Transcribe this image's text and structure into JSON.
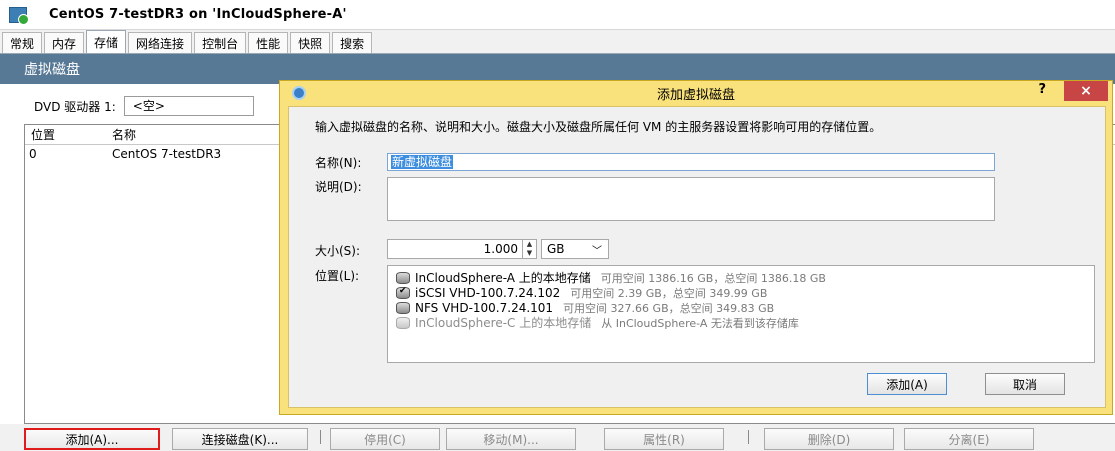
{
  "window": {
    "title": "CentOS 7-testDR3 on 'InCloudSphere-A'"
  },
  "tabs": [
    {
      "label": "常规",
      "active": false
    },
    {
      "label": "内存",
      "active": false
    },
    {
      "label": "存储",
      "active": true
    },
    {
      "label": "网络连接",
      "active": false
    },
    {
      "label": "控制台",
      "active": false
    },
    {
      "label": "性能",
      "active": false
    },
    {
      "label": "快照",
      "active": false
    },
    {
      "label": "搜索",
      "active": false
    }
  ],
  "section": {
    "title": "虚拟磁盘"
  },
  "dvd": {
    "label": "DVD 驱动器 1:",
    "value": "<空>"
  },
  "disk_table": {
    "columns": [
      "位置",
      "名称"
    ],
    "rows": [
      {
        "position": "0",
        "name": "CentOS 7-testDR3"
      }
    ]
  },
  "bottom_buttons": {
    "add": "添加(A)...",
    "attach": "连接磁盘(K)...",
    "deactivate": "停用(C)",
    "move": "移动(M)...",
    "properties": "属性(R)",
    "delete": "删除(D)",
    "detach": "分离(E)"
  },
  "dialog": {
    "title": "添加虚拟磁盘",
    "help": "?",
    "close": "×",
    "description": "输入虚拟磁盘的名称、说明和大小。磁盘大小及磁盘所属任何 VM 的主服务器设置将影响可用的存储位置。",
    "name_label": "名称(N):",
    "name_value": "新虚拟磁盘",
    "desc_label": "说明(D):",
    "desc_value": "",
    "size_label": "大小(S):",
    "size_value": "1.000",
    "size_unit": "GB",
    "location_label": "位置(L):",
    "locations": [
      {
        "name": "InCloudSphere-A 上的本地存储",
        "info": "可用空间 1386.16 GB，总空间 1386.18 GB",
        "state": "normal"
      },
      {
        "name": "iSCSI VHD-100.7.24.102",
        "info": "可用空间 2.39 GB，总空间 349.99 GB",
        "state": "selected"
      },
      {
        "name": "NFS VHD-100.7.24.101",
        "info": "可用空间 327.66 GB，总空间 349.83 GB",
        "state": "normal"
      },
      {
        "name": "InCloudSphere-C 上的本地存储",
        "info": "从 InCloudSphere-A 无法看到该存储库",
        "state": "disabled"
      }
    ],
    "add_button": "添加(A)",
    "cancel_button": "取消"
  },
  "colors": {
    "section_header": "#587995",
    "dialog_frame": "#f9e27c",
    "close_button": "#c74545",
    "highlight_border": "#e01b1b"
  }
}
